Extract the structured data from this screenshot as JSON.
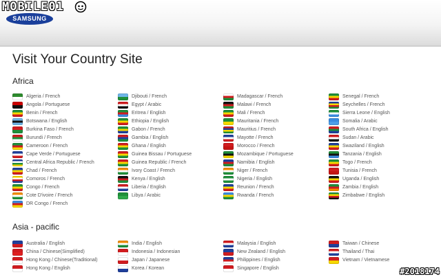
{
  "watermark": {
    "top": "MOBILE01",
    "bottom": "#2018174"
  },
  "logo": "SAMSUNG",
  "page_title": "Visit Your Country Site",
  "regions": [
    {
      "title": "Africa",
      "columns": [
        [
          {
            "label": "Algeria / French",
            "colors": [
              "#2e8b2e",
              "#ffffff"
            ]
          },
          {
            "label": "Angola / Portuguese",
            "colors": [
              "#cc0000",
              "#111111"
            ]
          },
          {
            "label": "Benin / French",
            "colors": [
              "#1f8f3a",
              "#f6d800",
              "#d01c1f"
            ]
          },
          {
            "label": "Botswana / English",
            "colors": [
              "#6fb6e8",
              "#111111",
              "#6fb6e8"
            ]
          },
          {
            "label": "Burkina Faso / French",
            "colors": [
              "#d01c1f",
              "#1f8f3a"
            ]
          },
          {
            "label": "Burundi / French",
            "colors": [
              "#d01c1f",
              "#1f8f3a",
              "#ffffff"
            ]
          },
          {
            "label": "Cameroon / French",
            "colors": [
              "#1f8f3a",
              "#d01c1f",
              "#f6d800"
            ]
          },
          {
            "label": "Cape Verde / Portuguese",
            "colors": [
              "#1f3f9b",
              "#ffffff",
              "#d01c1f"
            ]
          },
          {
            "label": "Central Africa Republic / French",
            "colors": [
              "#1f3f9b",
              "#ffffff",
              "#1f8f3a",
              "#f6d800"
            ]
          },
          {
            "label": "Chad / French",
            "colors": [
              "#1f3f9b",
              "#f6d800",
              "#d01c1f"
            ]
          },
          {
            "label": "Comoros / French",
            "colors": [
              "#f6d800",
              "#ffffff",
              "#d01c1f",
              "#1f3f9b"
            ]
          },
          {
            "label": "Congo / French",
            "colors": [
              "#1f8f3a",
              "#f6d800",
              "#d01c1f"
            ]
          },
          {
            "label": "Cote D'ivoire / French",
            "colors": [
              "#f28c00",
              "#ffffff",
              "#1f8f3a"
            ]
          },
          {
            "label": "DR Congo / French",
            "colors": [
              "#3a8be0",
              "#d01c1f",
              "#f6d800"
            ]
          }
        ],
        [
          {
            "label": "Djibouti / French",
            "colors": [
              "#6fb6e8",
              "#1f8f3a"
            ]
          },
          {
            "label": "Egypt / Arabic",
            "colors": [
              "#d01c1f",
              "#ffffff",
              "#111111"
            ]
          },
          {
            "label": "Eritrea / English",
            "colors": [
              "#1f8f3a",
              "#d01c1f",
              "#3a8be0"
            ]
          },
          {
            "label": "Ethiopia / English",
            "colors": [
              "#1f8f3a",
              "#f6d800",
              "#d01c1f"
            ]
          },
          {
            "label": "Gabon / French",
            "colors": [
              "#1f8f3a",
              "#f6d800",
              "#1f3f9b"
            ]
          },
          {
            "label": "Gambia / English",
            "colors": [
              "#d01c1f",
              "#1f3f9b",
              "#1f8f3a"
            ]
          },
          {
            "label": "Ghana / English",
            "colors": [
              "#d01c1f",
              "#f6d800",
              "#1f8f3a"
            ]
          },
          {
            "label": "Guinea Bissau / Portuguese",
            "colors": [
              "#d01c1f",
              "#f6d800",
              "#1f8f3a"
            ]
          },
          {
            "label": "Guinea Republic / French",
            "colors": [
              "#d01c1f",
              "#f6d800",
              "#1f8f3a"
            ]
          },
          {
            "label": "Ivory Coast / French",
            "colors": [
              "#f28c00",
              "#ffffff",
              "#1f8f3a"
            ]
          },
          {
            "label": "Kenya / English",
            "colors": [
              "#111111",
              "#d01c1f",
              "#1f8f3a"
            ]
          },
          {
            "label": "Liberia / English",
            "colors": [
              "#d01c1f",
              "#ffffff",
              "#1f3f9b"
            ]
          },
          {
            "label": "Libya / Arabic",
            "colors": [
              "#1f8f3a",
              "#2ea84a"
            ]
          }
        ],
        [
          {
            "label": "Madagascar / French",
            "colors": [
              "#ffffff",
              "#d01c1f",
              "#1f8f3a"
            ]
          },
          {
            "label": "Malawi / French",
            "colors": [
              "#111111",
              "#d01c1f",
              "#1f8f3a"
            ]
          },
          {
            "label": "Mali / French",
            "colors": [
              "#1f8f3a",
              "#f6d800",
              "#d01c1f"
            ]
          },
          {
            "label": "Mauritania / French",
            "colors": [
              "#1f8f3a",
              "#f6d800"
            ]
          },
          {
            "label": "Mauritius / French",
            "colors": [
              "#d01c1f",
              "#1f3f9b",
              "#f6d800",
              "#1f8f3a"
            ]
          },
          {
            "label": "Mayotte / French",
            "colors": [
              "#1f3f9b",
              "#ffffff",
              "#d01c1f"
            ]
          },
          {
            "label": "Morocco / French",
            "colors": [
              "#d01c1f",
              "#c41414"
            ]
          },
          {
            "label": "Mozambique / Portuguese",
            "colors": [
              "#1f8f3a",
              "#111111",
              "#f6d800"
            ]
          },
          {
            "label": "Namibia / English",
            "colors": [
              "#1f3f9b",
              "#d01c1f",
              "#1f8f3a"
            ]
          },
          {
            "label": "Niger / French",
            "colors": [
              "#f28c00",
              "#ffffff",
              "#1f8f3a"
            ]
          },
          {
            "label": "Nigeria / English",
            "colors": [
              "#1f8f3a",
              "#ffffff",
              "#1f8f3a"
            ]
          },
          {
            "label": "Reunion / French",
            "colors": [
              "#1f3f9b",
              "#f6d800",
              "#d01c1f"
            ]
          },
          {
            "label": "Rwanda / French",
            "colors": [
              "#3a8be0",
              "#f6d800",
              "#1f8f3a"
            ]
          }
        ],
        [
          {
            "label": "Senegal / French",
            "colors": [
              "#1f8f3a",
              "#f6d800",
              "#d01c1f"
            ]
          },
          {
            "label": "Seychelles / French",
            "colors": [
              "#1f3f9b",
              "#f6d800",
              "#d01c1f",
              "#1f8f3a"
            ]
          },
          {
            "label": "Sierra Leone / English",
            "colors": [
              "#1f8f3a",
              "#ffffff",
              "#3a8be0"
            ]
          },
          {
            "label": "Somalia / Arabic",
            "colors": [
              "#3a8be0",
              "#4d9ee8"
            ]
          },
          {
            "label": "South Africa / English",
            "colors": [
              "#d01c1f",
              "#1f8f3a",
              "#1f3f9b"
            ]
          },
          {
            "label": "Sudan / Arabic",
            "colors": [
              "#d01c1f",
              "#ffffff",
              "#111111"
            ]
          },
          {
            "label": "Swaziland / English",
            "colors": [
              "#1f3f9b",
              "#f6d800",
              "#d01c1f"
            ]
          },
          {
            "label": "Tanzania / English",
            "colors": [
              "#1f8f3a",
              "#111111",
              "#3a8be0"
            ]
          },
          {
            "label": "Togo / French",
            "colors": [
              "#1f8f3a",
              "#f6d800",
              "#d01c1f"
            ]
          },
          {
            "label": "Tunisia / French",
            "colors": [
              "#d01c1f",
              "#c41414"
            ]
          },
          {
            "label": "Uganda / English",
            "colors": [
              "#111111",
              "#f6d800",
              "#d01c1f"
            ]
          },
          {
            "label": "Zambia / English",
            "colors": [
              "#1f8f3a",
              "#d01c1f",
              "#f28c00"
            ]
          },
          {
            "label": "Zimbabwe / English",
            "colors": [
              "#1f8f3a",
              "#f6d800",
              "#d01c1f",
              "#111111"
            ]
          }
        ]
      ]
    },
    {
      "title": "Asia - pacific",
      "columns": [
        [
          {
            "label": "Australia / English",
            "colors": [
              "#1f3f9b",
              "#d01c1f"
            ]
          },
          {
            "label": "China / Chinese(Simplified)",
            "colors": [
              "#d01c1f",
              "#e02020"
            ]
          },
          {
            "label": "Hong Kong / Chinese(Traditional)",
            "colors": [
              "#d01c1f",
              "#ffffff"
            ]
          },
          {
            "label": "Hong Kong / English",
            "colors": [
              "#d01c1f",
              "#ffffff"
            ]
          }
        ],
        [
          {
            "label": "India / English",
            "colors": [
              "#f28c00",
              "#ffffff",
              "#1f8f3a"
            ]
          },
          {
            "label": "Indonesia / Indonesian",
            "colors": [
              "#d01c1f",
              "#ffffff"
            ]
          },
          {
            "label": "Japan / Japanese",
            "colors": [
              "#ffffff",
              "#d01c1f"
            ]
          },
          {
            "label": "Korea / Korean",
            "colors": [
              "#ffffff",
              "#1f3f9b"
            ]
          }
        ],
        [
          {
            "label": "Malaysia / English",
            "colors": [
              "#d01c1f",
              "#ffffff",
              "#1f3f9b"
            ]
          },
          {
            "label": "New Zealand / English",
            "colors": [
              "#1f3f9b",
              "#d01c1f"
            ]
          },
          {
            "label": "Philippines / English",
            "colors": [
              "#1f3f9b",
              "#d01c1f",
              "#ffffff"
            ]
          },
          {
            "label": "Singapore / English",
            "colors": [
              "#d01c1f",
              "#ffffff"
            ]
          }
        ],
        [
          {
            "label": "Taiwan / Chinese",
            "colors": [
              "#d01c1f",
              "#1f3f9b"
            ]
          },
          {
            "label": "Thailand / Thai",
            "colors": [
              "#d01c1f",
              "#ffffff",
              "#1f3f9b"
            ]
          },
          {
            "label": "Vietnam / Vietnamese",
            "colors": [
              "#d01c1f",
              "#f6d800"
            ]
          }
        ]
      ]
    }
  ]
}
